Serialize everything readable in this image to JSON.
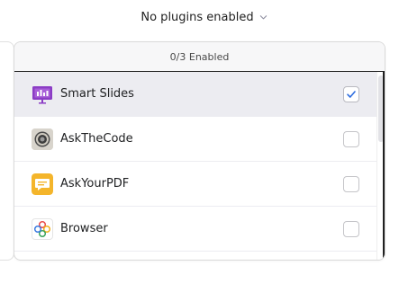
{
  "top_select": {
    "label": "No plugins enabled"
  },
  "panel": {
    "header": "0/3 Enabled",
    "plugins": [
      {
        "name": "Smart Slides",
        "checked": true,
        "icon": "slides-icon"
      },
      {
        "name": "AskTheCode",
        "checked": false,
        "icon": "code-seal-icon"
      },
      {
        "name": "AskYourPDF",
        "checked": false,
        "icon": "pdf-bubble-icon"
      },
      {
        "name": "Browser",
        "checked": false,
        "icon": "browser-flower-icon"
      }
    ]
  },
  "colors": {
    "check_color": "#2d6cdf",
    "slides_purple": "#8b3cc5",
    "pdf_yellow": "#f4b52b"
  }
}
